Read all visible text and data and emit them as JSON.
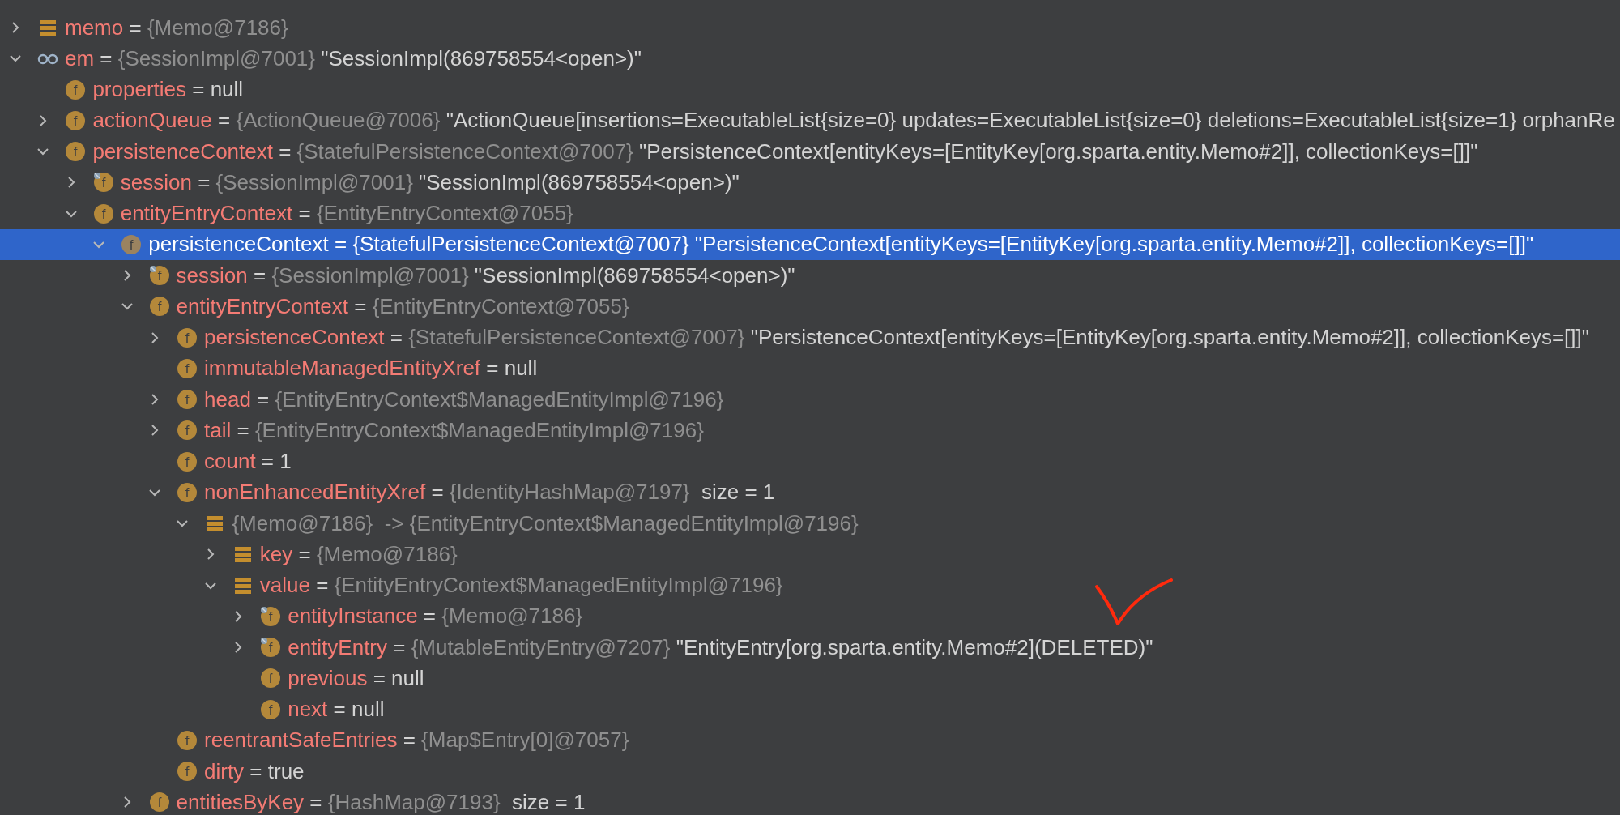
{
  "tree": [
    {
      "kind": "list",
      "name": "memo",
      "eq": "=",
      "type": "{Memo@7186}",
      "expanded": false,
      "selected": false
    },
    {
      "kind": "watch",
      "name": "em",
      "eq": "=",
      "type": "{SessionImpl@7001}",
      "value": "\"SessionImpl(869758554<open>)\"",
      "expanded": true,
      "selected": false,
      "children": [
        {
          "kind": "field",
          "badge": "f",
          "name": "properties",
          "eq": "=",
          "value": "null",
          "selected": false
        },
        {
          "kind": "field",
          "badge": "f",
          "name": "actionQueue",
          "eq": "=",
          "type": "{ActionQueue@7006}",
          "value": "\"ActionQueue[insertions=ExecutableList{size=0} updates=ExecutableList{size=0} deletions=ExecutableList{size=1} orphanRe",
          "expanded": false,
          "selected": false
        },
        {
          "kind": "field",
          "badge": "f",
          "name": "persistenceContext",
          "eq": "=",
          "type": "{StatefulPersistenceContext@7007}",
          "value": "\"PersistenceContext[entityKeys=[EntityKey[org.sparta.entity.Memo#2]], collectionKeys=[]]\"",
          "expanded": true,
          "selected": false,
          "children": [
            {
              "kind": "field-marked",
              "badge": "f",
              "name": "session",
              "eq": "=",
              "type": "{SessionImpl@7001}",
              "value": "\"SessionImpl(869758554<open>)\"",
              "expanded": false,
              "selected": false
            },
            {
              "kind": "field",
              "badge": "f",
              "name": "entityEntryContext",
              "eq": "=",
              "type": "{EntityEntryContext@7055}",
              "expanded": true,
              "selected": false,
              "children": [
                {
                  "kind": "field",
                  "badge": "f",
                  "name": "persistenceContext",
                  "eq": "=",
                  "type": "{StatefulPersistenceContext@7007}",
                  "value": "\"PersistenceContext[entityKeys=[EntityKey[org.sparta.entity.Memo#2]], collectionKeys=[]]\"",
                  "expanded": true,
                  "selected": true,
                  "children": [
                    {
                      "kind": "field-marked",
                      "badge": "f",
                      "name": "session",
                      "eq": "=",
                      "type": "{SessionImpl@7001}",
                      "value": "\"SessionImpl(869758554<open>)\"",
                      "expanded": false,
                      "selected": false
                    },
                    {
                      "kind": "field",
                      "badge": "f",
                      "name": "entityEntryContext",
                      "eq": "=",
                      "type": "{EntityEntryContext@7055}",
                      "expanded": true,
                      "selected": false,
                      "children": [
                        {
                          "kind": "field",
                          "badge": "f",
                          "name": "persistenceContext",
                          "eq": "=",
                          "type": "{StatefulPersistenceContext@7007}",
                          "value": "\"PersistenceContext[entityKeys=[EntityKey[org.sparta.entity.Memo#2]], collectionKeys=[]]\"",
                          "expanded": false,
                          "selected": false
                        },
                        {
                          "kind": "field",
                          "badge": "f",
                          "name": "immutableManagedEntityXref",
                          "eq": "=",
                          "value": "null",
                          "selected": false
                        },
                        {
                          "kind": "field",
                          "badge": "f",
                          "name": "head",
                          "eq": "=",
                          "type": "{EntityEntryContext$ManagedEntityImpl@7196}",
                          "expanded": false,
                          "selected": false
                        },
                        {
                          "kind": "field",
                          "badge": "f",
                          "name": "tail",
                          "eq": "=",
                          "type": "{EntityEntryContext$ManagedEntityImpl@7196}",
                          "expanded": false,
                          "selected": false
                        },
                        {
                          "kind": "field",
                          "badge": "f",
                          "name": "count",
                          "eq": "=",
                          "value": "1",
                          "selected": false
                        },
                        {
                          "kind": "field",
                          "badge": "f",
                          "name": "nonEnhancedEntityXref",
                          "eq": "=",
                          "type": "{IdentityHashMap@7197}",
                          "extra": "size = 1",
                          "expanded": true,
                          "selected": false,
                          "children": [
                            {
                              "kind": "list",
                              "type": "{Memo@7186}",
                              "arrow": "->",
                              "target": "{EntityEntryContext$ManagedEntityImpl@7196}",
                              "expanded": true,
                              "selected": false,
                              "children": [
                                {
                                  "kind": "list",
                                  "name": "key",
                                  "eq": "=",
                                  "type": "{Memo@7186}",
                                  "expanded": false,
                                  "selected": false
                                },
                                {
                                  "kind": "list",
                                  "name": "value",
                                  "eq": "=",
                                  "type": "{EntityEntryContext$ManagedEntityImpl@7196}",
                                  "expanded": true,
                                  "selected": false,
                                  "children": [
                                    {
                                      "kind": "field-marked",
                                      "badge": "f",
                                      "name": "entityInstance",
                                      "eq": "=",
                                      "type": "{Memo@7186}",
                                      "expanded": false,
                                      "selected": false
                                    },
                                    {
                                      "kind": "field-marked",
                                      "badge": "f",
                                      "name": "entityEntry",
                                      "eq": "=",
                                      "type": "{MutableEntityEntry@7207}",
                                      "value": "\"EntityEntry[org.sparta.entity.Memo#2](DELETED)\"",
                                      "expanded": false,
                                      "selected": false
                                    },
                                    {
                                      "kind": "field",
                                      "badge": "f",
                                      "name": "previous",
                                      "eq": "=",
                                      "value": "null",
                                      "selected": false
                                    },
                                    {
                                      "kind": "field",
                                      "badge": "f",
                                      "name": "next",
                                      "eq": "=",
                                      "value": "null",
                                      "selected": false
                                    }
                                  ]
                                }
                              ]
                            }
                          ]
                        },
                        {
                          "kind": "field",
                          "badge": "f",
                          "name": "reentrantSafeEntries",
                          "eq": "=",
                          "type": "{Map$Entry[0]@7057}",
                          "selected": false
                        },
                        {
                          "kind": "field",
                          "badge": "f",
                          "name": "dirty",
                          "eq": "=",
                          "value": "true",
                          "selected": false
                        }
                      ]
                    },
                    {
                      "kind": "field",
                      "badge": "f",
                      "name": "entitiesByKey",
                      "eq": "=",
                      "type": "{HashMap@7193}",
                      "extra": "size = 1",
                      "expanded": false,
                      "selected": false
                    }
                  ]
                }
              ]
            }
          ]
        }
      ]
    }
  ],
  "annotation": {
    "kind": "checkmark"
  }
}
